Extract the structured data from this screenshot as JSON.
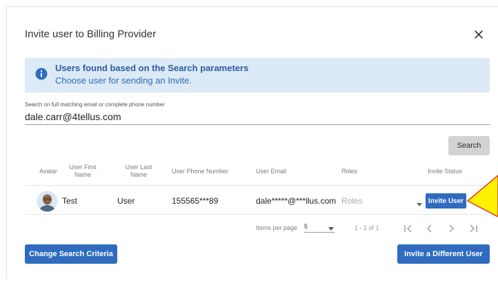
{
  "dialog": {
    "title": "Invite user to Billing Provider"
  },
  "banner": {
    "title": "Users found based on the Search parameters",
    "subtitle": "Choose user for sending an Invite."
  },
  "search": {
    "label": "Search on full matching email or complete phone number",
    "value": "dale.carr@4tellus.com",
    "button_label": "Search"
  },
  "table": {
    "columns": [
      "Avatar",
      "User First Name",
      "User Last Name",
      "User Phone Number",
      "User Email",
      "Roles",
      "Invite Status"
    ],
    "rows": [
      {
        "first_name": "Test",
        "last_name": "User",
        "phone": "155565***89",
        "email": "dale*****@***llus.com",
        "roles_placeholder": "Roles",
        "invite_button": "Invite User"
      }
    ]
  },
  "pagination": {
    "items_per_page_label": "Items per page",
    "items_per_page_value": "5",
    "range": "1 - 1 of 1"
  },
  "footer": {
    "change_search_label": "Change Search Criteria",
    "invite_different_label": "Invite a Different User"
  },
  "colors": {
    "primary": "#2f6bbf",
    "banner_bg": "#dce9f7",
    "banner_text": "#2c5f9e",
    "callout_fill": "#fff200",
    "callout_stroke": "#e53935"
  }
}
